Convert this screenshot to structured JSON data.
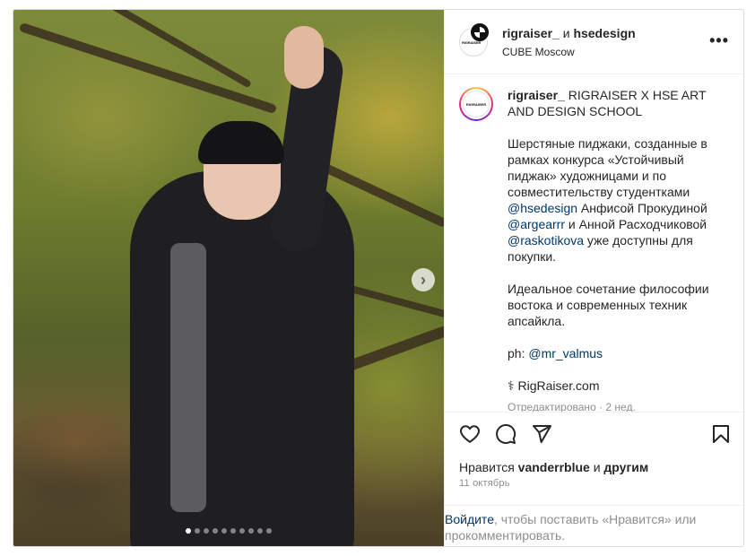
{
  "post": {
    "header": {
      "author1": "rigraiser_",
      "conjunction": "и",
      "author2": "hsedesign",
      "location": "CUBE Moscow",
      "more_icon": "more-horizontal-icon"
    },
    "caption": {
      "username": "rigraiser_",
      "title": "RIGRAISER X HSE ART AND DESIGN SCHOOL",
      "p2_part1": "Шерстяные пиджаки, созданные в рамках конкурса «Устойчивый пиджак» художницами и по совместительству студентками ",
      "mention1": "@hsedesign",
      "p2_part2": " Анфисой Прокудиной ",
      "mention2": "@argearrr",
      "p2_part3": " и Анной Расходчиковой ",
      "mention3": "@raskotikova",
      "p2_part4": " уже доступны для покупки.",
      "p3": "Идеальное сочетание философии востока и современных техник апсайкла.",
      "ph_label": "ph: ",
      "mention4": "@mr_valmus",
      "link_symbol": "⚕",
      "link_text": "RigRaiser.com",
      "edited": "Отредактировано · 2 нед."
    },
    "avatar_logo_text": "RIGRAISER",
    "likes": {
      "prefix": "Нравится ",
      "user": "vanderrblue",
      "middle": " и ",
      "others": "другим"
    },
    "date": "11 октябрь",
    "login_prompt": {
      "link": "Войдите",
      "text": ", чтобы поставить «Нравится» или прокомментировать."
    },
    "carousel": {
      "total": 10,
      "active": 1
    },
    "colors": {
      "link": "#00376b",
      "muted": "#8e8e8e",
      "text": "#262626",
      "border": "#dbdbdb"
    }
  }
}
